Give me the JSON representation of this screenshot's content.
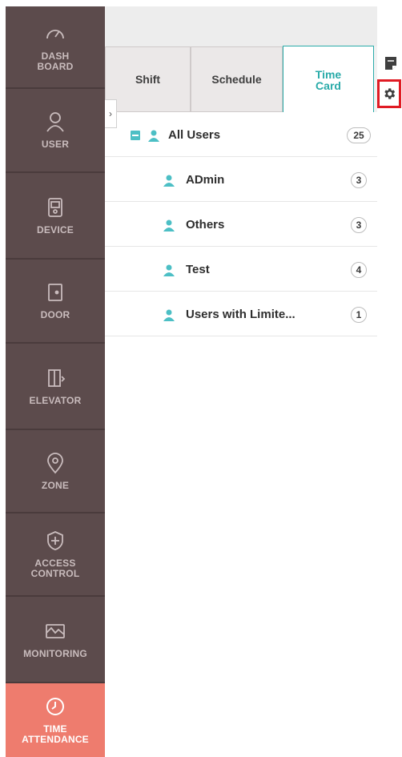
{
  "sidebar": {
    "items": [
      {
        "label": "DASH\nBOARD",
        "icon": "dashboard-icon"
      },
      {
        "label": "USER",
        "icon": "user-icon"
      },
      {
        "label": "DEVICE",
        "icon": "device-icon"
      },
      {
        "label": "DOOR",
        "icon": "door-icon"
      },
      {
        "label": "ELEVATOR",
        "icon": "elevator-icon"
      },
      {
        "label": "ZONE",
        "icon": "zone-icon"
      },
      {
        "label": "ACCESS\nCONTROL",
        "icon": "access-control-icon"
      },
      {
        "label": "MONITORING",
        "icon": "monitoring-icon"
      },
      {
        "label": "TIME\nATTENDANCE",
        "icon": "time-attendance-icon",
        "active": true
      }
    ],
    "background_color": "#5c4b4c",
    "active_color": "#ee7c6e"
  },
  "tabs": [
    {
      "label": "Shift"
    },
    {
      "label": "Schedule"
    },
    {
      "label": "Time\nCard",
      "active": true
    }
  ],
  "tree": {
    "rows": [
      {
        "label": "All Users",
        "count": "25",
        "level": 0,
        "collapsible": true
      },
      {
        "label": "ADmin",
        "count": "3",
        "level": 1
      },
      {
        "label": "Others",
        "count": "3",
        "level": 1
      },
      {
        "label": "Test",
        "count": "4",
        "level": 1
      },
      {
        "label": "Users with Limite...",
        "count": "1",
        "level": 1
      }
    ],
    "accent_color": "#4cbfc5"
  },
  "toolbar": {
    "notes_icon": "notes-icon",
    "settings_icon": "gear-icon",
    "highlight_color": "#e01b24"
  }
}
